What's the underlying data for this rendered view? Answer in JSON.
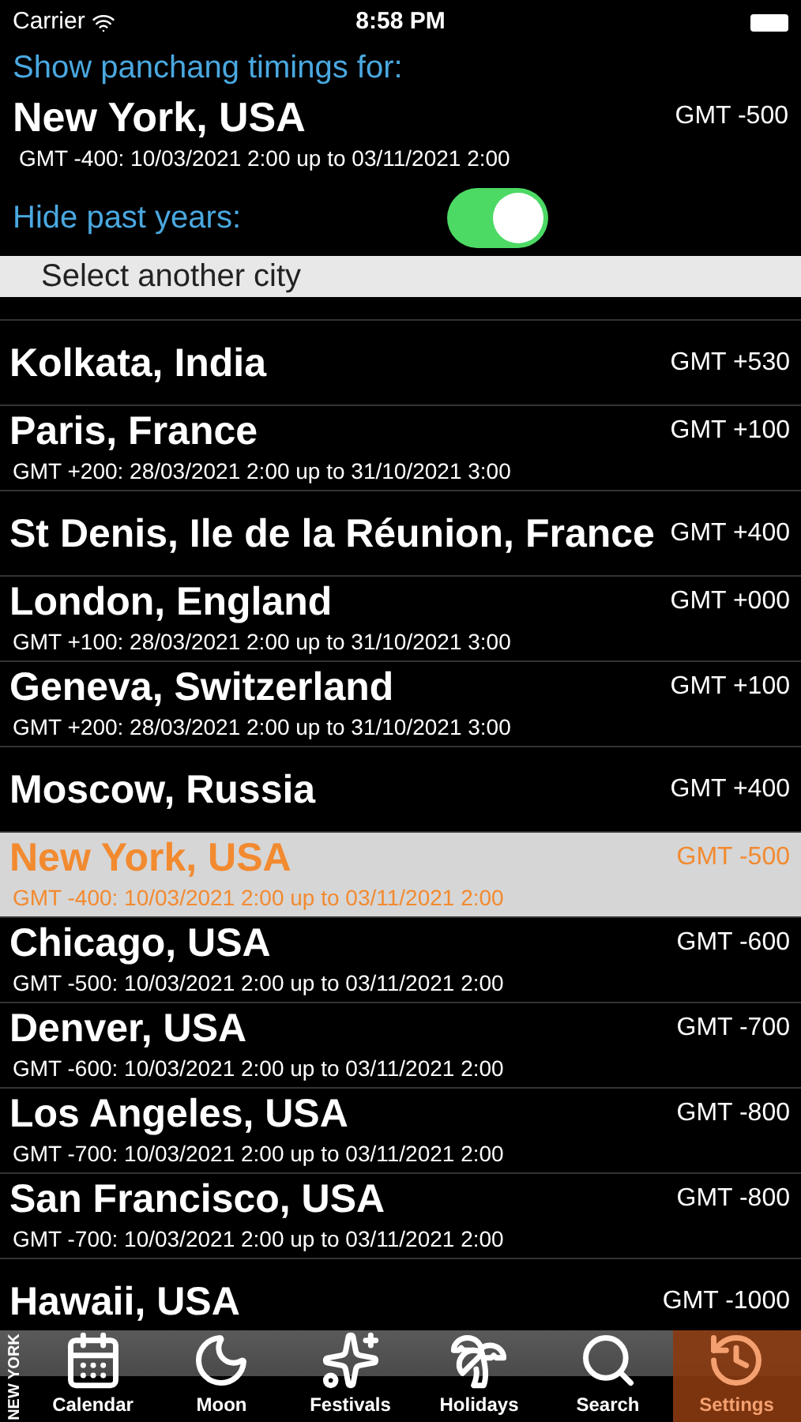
{
  "status_bar": {
    "carrier": "Carrier",
    "time": "8:58 PM"
  },
  "header": {
    "prompt": "Show panchang timings for:",
    "city": "New York, USA",
    "gmt": "GMT -500",
    "dst": "GMT -400: 10/03/2021 2:00 up to 03/11/2021 2:00",
    "hide_label": "Hide past years:",
    "hide_on": true
  },
  "section_title": "Select another city",
  "cities": [
    {
      "name": "Kolkata, India",
      "gmt": "GMT +530",
      "selected": false
    },
    {
      "name": "Paris, France",
      "gmt": "GMT +100",
      "dst": "GMT +200: 28/03/2021 2:00 up to 31/10/2021 3:00",
      "selected": false
    },
    {
      "name": "St Denis, Ile de la Réunion, France",
      "gmt": "GMT +400",
      "selected": false
    },
    {
      "name": "London, England",
      "gmt": "GMT +000",
      "dst": "GMT +100: 28/03/2021 2:00 up to 31/10/2021 3:00",
      "selected": false
    },
    {
      "name": "Geneva, Switzerland",
      "gmt": "GMT +100",
      "dst": "GMT +200: 28/03/2021 2:00 up to 31/10/2021 3:00",
      "selected": false
    },
    {
      "name": "Moscow, Russia",
      "gmt": "GMT +400",
      "selected": false
    },
    {
      "name": "New York, USA",
      "gmt": "GMT -500",
      "dst": "GMT -400: 10/03/2021 2:00 up to 03/11/2021 2:00",
      "selected": true
    },
    {
      "name": "Chicago, USA",
      "gmt": "GMT -600",
      "dst": "GMT -500: 10/03/2021 2:00 up to 03/11/2021 2:00",
      "selected": false
    },
    {
      "name": "Denver, USA",
      "gmt": "GMT -700",
      "dst": "GMT -600: 10/03/2021 2:00 up to 03/11/2021 2:00",
      "selected": false
    },
    {
      "name": "Los Angeles, USA",
      "gmt": "GMT -800",
      "dst": "GMT -700: 10/03/2021 2:00 up to 03/11/2021 2:00",
      "selected": false
    },
    {
      "name": "San Francisco, USA",
      "gmt": "GMT -800",
      "dst": "GMT -700: 10/03/2021 2:00 up to 03/11/2021 2:00",
      "selected": false
    },
    {
      "name": "Hawaii, USA",
      "gmt": "GMT -1000",
      "selected": false
    }
  ],
  "tab_bar": {
    "side_label": "NEW YORK",
    "tabs": [
      {
        "kind": "calendar",
        "label": "Calendar",
        "selected": false
      },
      {
        "kind": "moon",
        "label": "Moon",
        "selected": false
      },
      {
        "kind": "festivals",
        "label": "Festivals",
        "selected": false
      },
      {
        "kind": "holidays",
        "label": "Holidays",
        "selected": false
      },
      {
        "kind": "search",
        "label": "Search",
        "selected": false
      },
      {
        "kind": "settings",
        "label": "Settings",
        "selected": true
      }
    ]
  }
}
